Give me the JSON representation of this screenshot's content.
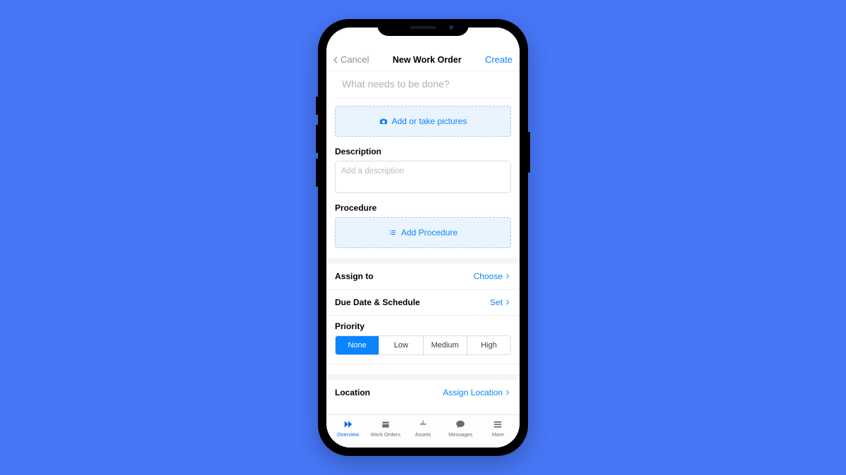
{
  "header": {
    "cancel": "Cancel",
    "title": "New Work Order",
    "create": "Create"
  },
  "titleField": {
    "placeholder": "What needs to be done?"
  },
  "pictures": {
    "label": "Add or take pictures"
  },
  "description": {
    "label": "Description",
    "placeholder": "Add a description"
  },
  "procedure": {
    "label": "Procedure",
    "button": "Add Procedure"
  },
  "assign": {
    "label": "Assign to",
    "action": "Choose"
  },
  "dueDate": {
    "label": "Due Date & Schedule",
    "action": "Set"
  },
  "priority": {
    "label": "Priority",
    "options": [
      "None",
      "Low",
      "Medium",
      "High"
    ],
    "selected": "None"
  },
  "location": {
    "label": "Location",
    "action": "Assign Location"
  },
  "tabs": [
    {
      "label": "Overview"
    },
    {
      "label": "Work Orders"
    },
    {
      "label": "Assets"
    },
    {
      "label": "Messages"
    },
    {
      "label": "More"
    }
  ]
}
